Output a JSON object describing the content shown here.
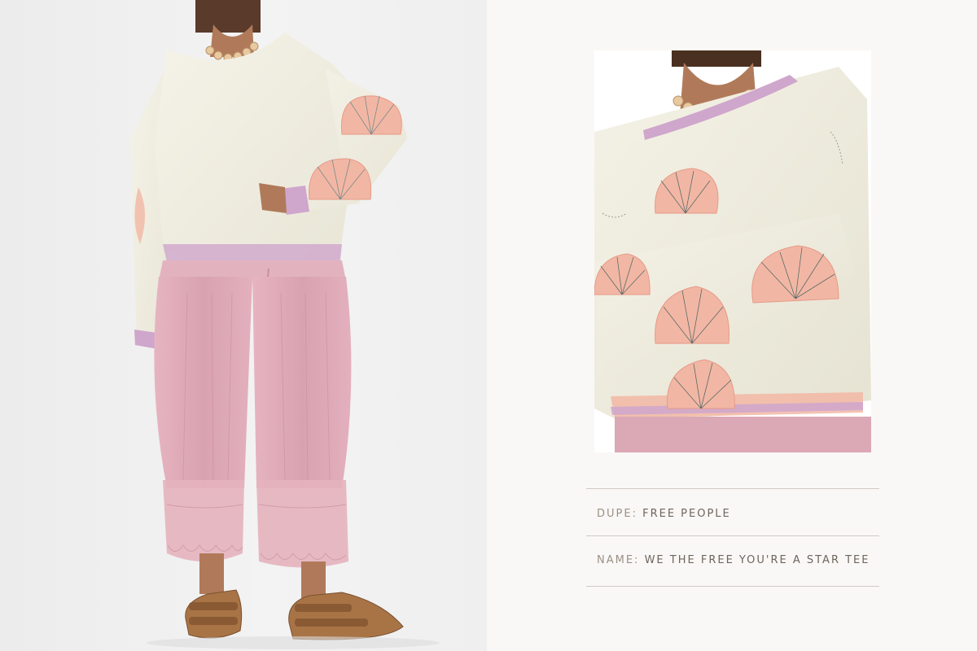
{
  "details": {
    "dupe_label": "DUPE:",
    "dupe_value": "FREE PEOPLE",
    "name_label": "NAME:",
    "name_value": "WE THE FREE YOU'RE A STAR TEE"
  },
  "colors": {
    "page_bg": "#faf8f6",
    "photo_bg": "#efefef",
    "tee": "#f2f0e4",
    "shell_pink": "#f2b7a4",
    "pants_pink": "#dba8b5",
    "trim_lavender": "#cfa6cc",
    "sandal_brown": "#a87446",
    "label_gray": "#9a9086",
    "value_gray": "#6e655d",
    "rule_gray": "#cfcac5"
  },
  "images": {
    "model_photo": "model-wearing-shell-tee-and-pink-bloomers",
    "product_photo": "shell-sleeve-tee-closeup"
  }
}
